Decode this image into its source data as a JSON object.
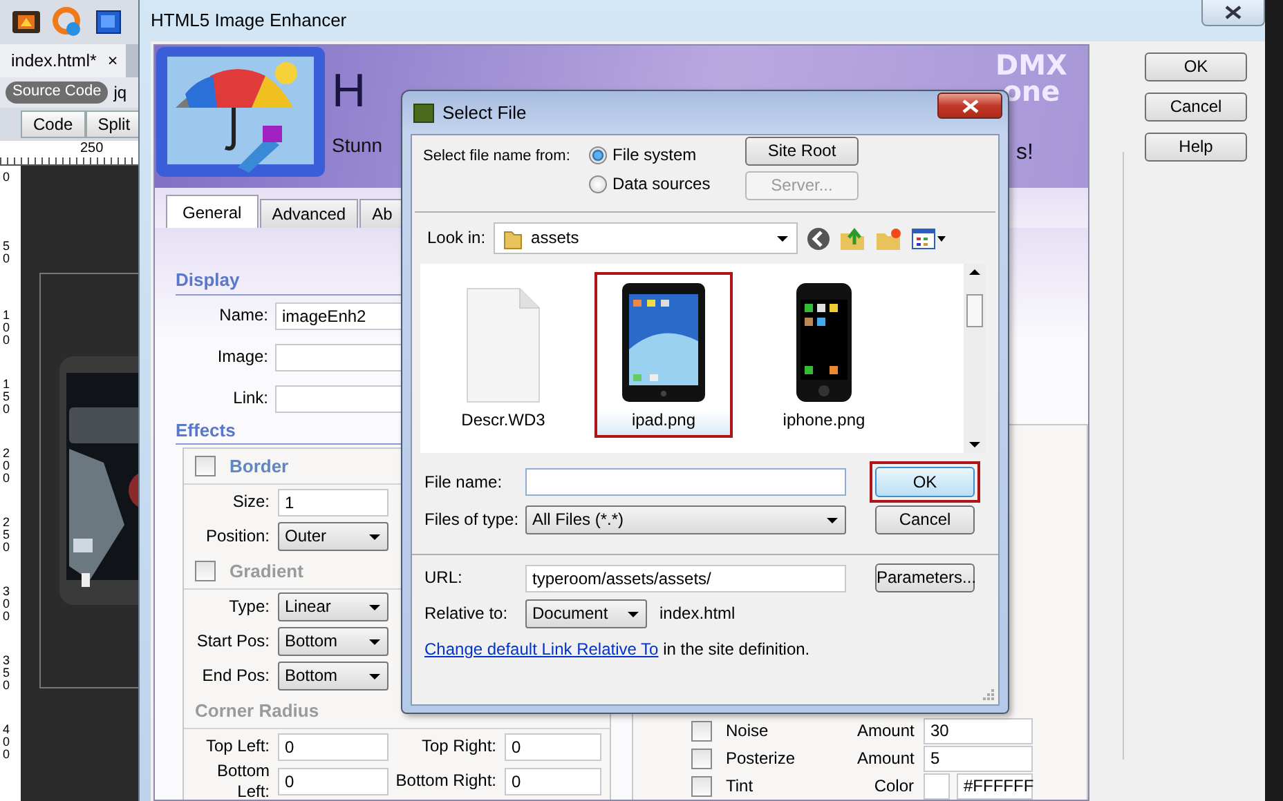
{
  "editor": {
    "document_tab": {
      "label": "index.html*",
      "close": "×"
    },
    "source_code": "Source Code",
    "related_file": "jq",
    "view_buttons": [
      "Code",
      "Split"
    ],
    "ruler_label": "250",
    "vertical_ruler": [
      "0",
      "50",
      "100",
      "150",
      "200",
      "250",
      "300",
      "350",
      "400"
    ]
  },
  "enhancer": {
    "title": "HTML5 Image Enhancer",
    "header_title": "H",
    "tagline_start": "Stunn",
    "tagline_end": "s!",
    "logo": {
      "top": "DMX",
      "bottom": "one"
    },
    "tabs": [
      {
        "label": "General",
        "selected": true
      },
      {
        "label": "Advanced",
        "selected": false
      },
      {
        "label": "Ab",
        "selected": false
      }
    ],
    "display": {
      "heading": "Display",
      "fields": [
        {
          "label": "Name:",
          "value": "imageEnh2"
        },
        {
          "label": "Image:"
        },
        {
          "label": "Link:"
        }
      ]
    },
    "effects": {
      "heading": "Effects",
      "sections": [
        {
          "kind": "checkbox",
          "title": "Border",
          "checked": false,
          "disabled": false,
          "rows": [
            {
              "kind": "input",
              "label": "Size:",
              "value": "1"
            },
            {
              "kind": "select",
              "label": "Position:",
              "value": "Outer"
            }
          ]
        },
        {
          "kind": "checkbox",
          "title": "Gradient",
          "checked": false,
          "disabled": true,
          "rows": [
            {
              "kind": "select",
              "label": "Type:",
              "value": "Linear"
            },
            {
              "kind": "select",
              "label": "Start Pos:",
              "value": "Bottom"
            },
            {
              "kind": "select",
              "label": "End Pos:",
              "value": "Bottom"
            }
          ]
        },
        {
          "kind": "plain",
          "title": "Corner Radius",
          "disabled": true,
          "rows": [
            {
              "kind": "pair",
              "label": "Top Left:",
              "value": "0",
              "label_2": "Top Right:",
              "value_2": "0"
            },
            {
              "kind": "pair",
              "label": "Bottom Left:",
              "value": "0",
              "label_2": "Bottom Right:",
              "value_2": "0"
            }
          ]
        }
      ],
      "filters": [
        {
          "kind": "amount",
          "label": "Noise",
          "checked": false,
          "field_label": "Amount",
          "value": "30"
        },
        {
          "kind": "amount",
          "label": "Posterize",
          "checked": false,
          "field_label": "Amount",
          "value": "5"
        },
        {
          "kind": "color",
          "label": "Tint",
          "checked": false,
          "field_label": "Color",
          "value": "#FFFFFF"
        }
      ]
    },
    "buttons": [
      "OK",
      "Cancel",
      "Help"
    ]
  },
  "dialog": {
    "title": "Select File",
    "source_label": "Select file name from:",
    "sources": [
      {
        "label": "File system",
        "selected": true
      },
      {
        "label": "Data sources",
        "selected": false
      }
    ],
    "side_buttons": [
      {
        "label": "Site Root",
        "disabled": false
      },
      {
        "label": "Server...",
        "disabled": true
      }
    ],
    "look_in_label": "Look in:",
    "folder": "assets",
    "files": [
      {
        "name": "Descr.WD3",
        "kind": "document",
        "selected": false
      },
      {
        "name": "ipad.png",
        "kind": "tablet",
        "selected": true
      },
      {
        "name": "iphone.png",
        "kind": "phone",
        "selected": false
      }
    ],
    "file_name_label": "File name:",
    "ok": {
      "label": "OK",
      "highlighted": true
    },
    "files_of_type_label": "Files of type:",
    "files_of_type": "All Files (*.*)",
    "cancel": "Cancel",
    "url_label": "URL:",
    "url": "typeroom/assets/assets/",
    "parameters": "Parameters...",
    "relative_label": "Relative to:",
    "relative_to": "Document",
    "relative_file": "index.html",
    "note_link": "Change default Link Relative To",
    "note_rest": " in the site definition."
  }
}
